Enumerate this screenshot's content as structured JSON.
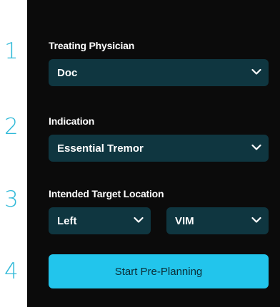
{
  "steps": [
    {
      "number": "1",
      "label": "Treating Physician",
      "value": "Doc"
    },
    {
      "number": "2",
      "label": "Indication",
      "value": "Essential Tremor"
    },
    {
      "number": "3",
      "label": "Intended Target Location",
      "side_value": "Left",
      "target_value": "VIM"
    }
  ],
  "action": {
    "number": "4",
    "label": "Start Pre-Planning"
  },
  "icons": {
    "dropdown": "chevron-down-icon"
  },
  "colors": {
    "panel_bg": "#0b0b0b",
    "select_bg": "#0f3640",
    "accent": "#22c5ec",
    "step_number": "#2fb9d8"
  }
}
